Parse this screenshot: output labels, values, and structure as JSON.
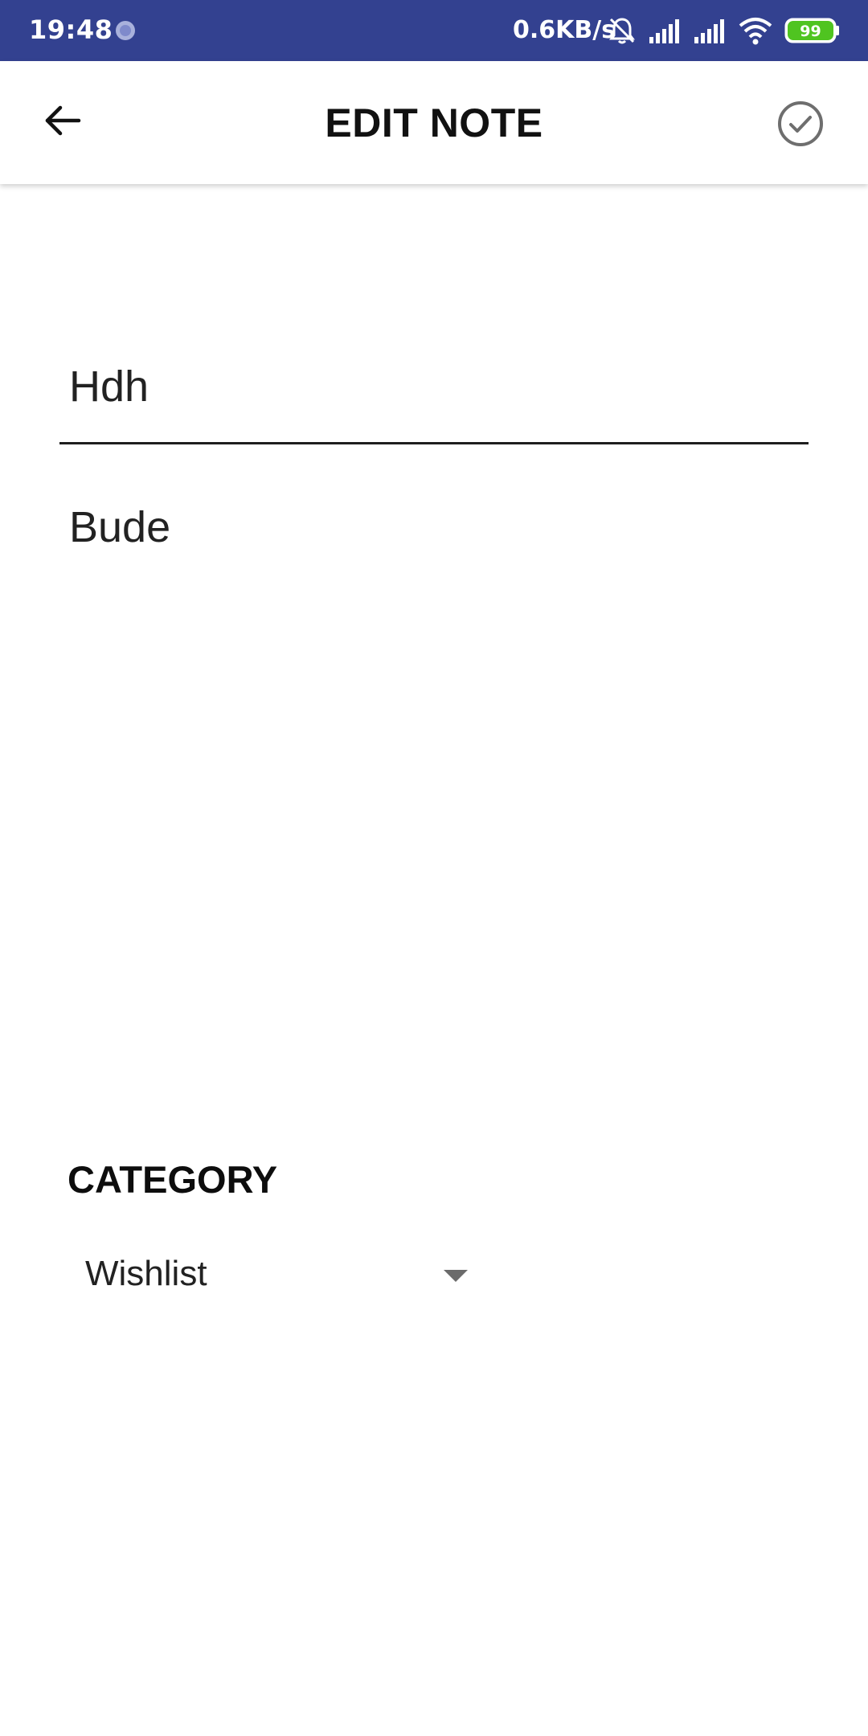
{
  "status_bar": {
    "time": "19:48",
    "network_speed": "0.6KB/s",
    "battery_level": "99",
    "icons": [
      "sync-icon",
      "bell-off-icon",
      "signal-icon",
      "signal-icon",
      "wifi-icon",
      "battery-icon"
    ],
    "background_color": "#334190",
    "battery_color": "#4fc420"
  },
  "app_bar": {
    "title": "EDIT NOTE",
    "back_icon": "arrow-left-icon",
    "save_icon": "check-circle-icon"
  },
  "note": {
    "title": "Hdh",
    "body": "Bude"
  },
  "category": {
    "label": "CATEGORY",
    "selected": "Wishlist",
    "dropdown_icon": "triangle-down-icon"
  }
}
